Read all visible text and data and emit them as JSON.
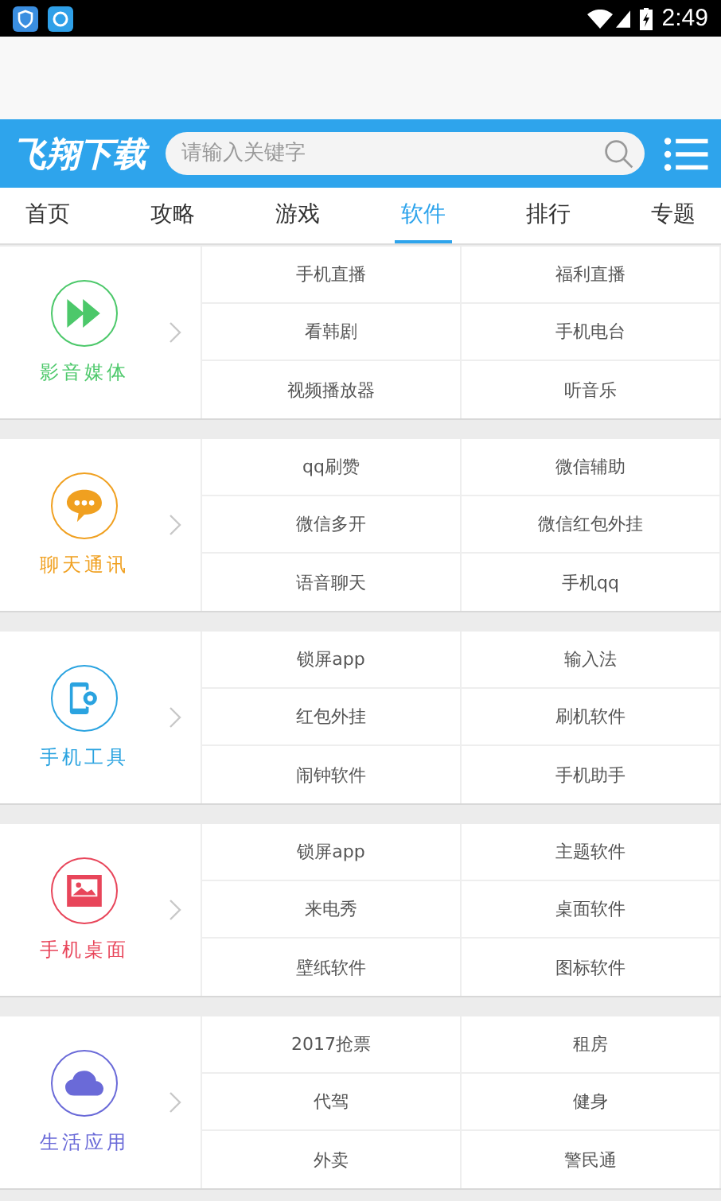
{
  "status_bar": {
    "time": "2:49"
  },
  "header": {
    "logo": "飞翔下载",
    "search": {
      "placeholder": "请输入关键字"
    }
  },
  "tabs": [
    {
      "label": "首页",
      "selected": false
    },
    {
      "label": "攻略",
      "selected": false
    },
    {
      "label": "游戏",
      "selected": false
    },
    {
      "label": "软件",
      "selected": true
    },
    {
      "label": "排行",
      "selected": false
    },
    {
      "label": "专题",
      "selected": false
    }
  ],
  "categories": [
    {
      "kind": "media",
      "name": "影音媒体",
      "color": "#4cc86a",
      "items": [
        "手机直播",
        "福利直播",
        "看韩剧",
        "手机电台",
        "视频播放器",
        "听音乐"
      ]
    },
    {
      "kind": "chat",
      "name": "聊天通讯",
      "color": "#f0a020",
      "items": [
        "qq刷赞",
        "微信辅助",
        "微信多开",
        "微信红包外挂",
        "语音聊天",
        "手机qq"
      ]
    },
    {
      "kind": "tools",
      "name": "手机工具",
      "color": "#2aa3e0",
      "items": [
        "锁屏app",
        "输入法",
        "红包外挂",
        "刷机软件",
        "闹钟软件",
        "手机助手"
      ]
    },
    {
      "kind": "desktop",
      "name": "手机桌面",
      "color": "#e8455a",
      "items": [
        "锁屏app",
        "主题软件",
        "来电秀",
        "桌面软件",
        "壁纸软件",
        "图标软件"
      ]
    },
    {
      "kind": "life",
      "name": "生活应用",
      "color": "#6a6ad8",
      "items": [
        "2017抢票",
        "租房",
        "代驾",
        "健身",
        "外卖",
        "警民通"
      ]
    }
  ]
}
